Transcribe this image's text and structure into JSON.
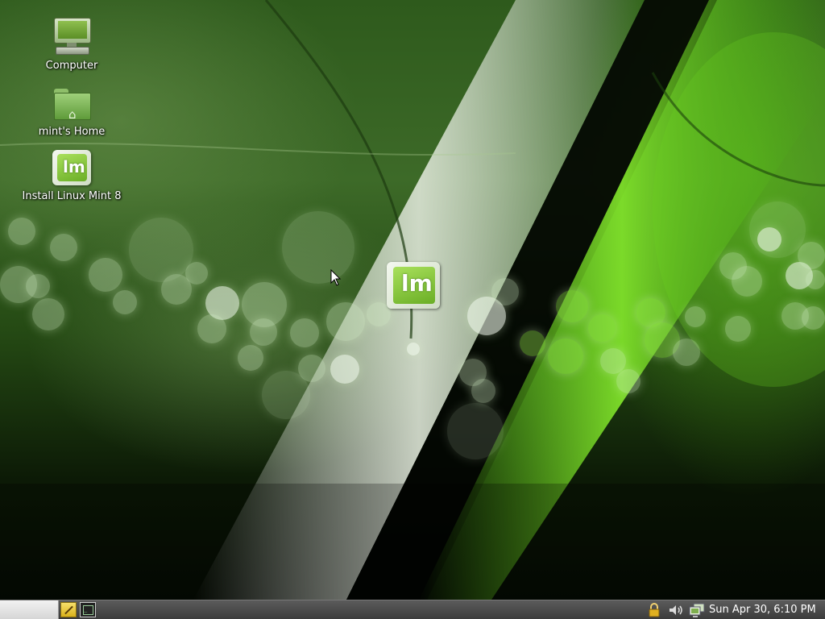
{
  "desktop": {
    "icons": [
      {
        "label": "Computer",
        "icon": "computer-icon"
      },
      {
        "label": "mint's Home",
        "icon": "home-folder-icon"
      },
      {
        "label": "Install Linux Mint 8",
        "icon": "linux-mint-logo-icon"
      }
    ],
    "wallpaper_logo_text": "lm"
  },
  "panel": {
    "menu_button": "",
    "launchers": [
      "text-editor-icon",
      "terminal-icon"
    ],
    "tray": [
      "lock-icon",
      "volume-icon",
      "network-icon"
    ],
    "clock": "Sun Apr 30,  6:10 PM"
  },
  "colors": {
    "panel_bg": "#4a4a4a",
    "mint_green": "#7dc242",
    "wallpaper_dark": "#0c1a06"
  }
}
